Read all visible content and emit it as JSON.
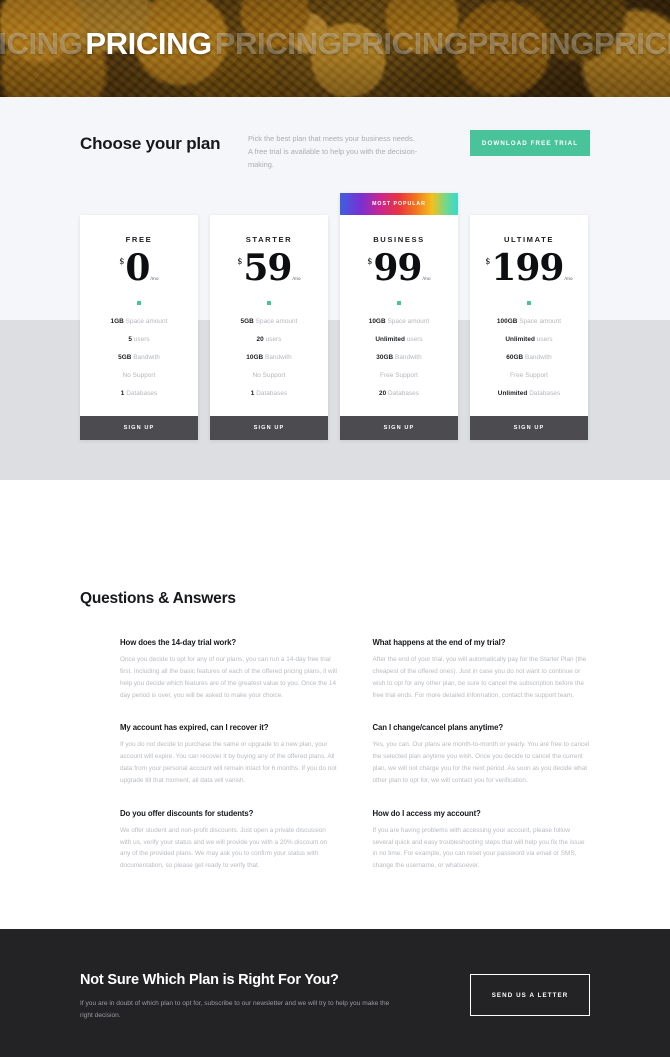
{
  "hero": {
    "title": "PRICING",
    "ghost_before": "PRICING",
    "ghost_after_1": "PRICING",
    "ghost_after_2": "PRICING",
    "ghost_after_3": "PRICING",
    "ghost_after_4": "PRICING",
    "background": "gold-coins-photo"
  },
  "plans_section": {
    "heading": "Choose your plan",
    "subtext": "Pick the best plan that meets your business needs. A free trial is available to help you with the decision-making.",
    "trial_button": "DOWNLOAD FREE TRIAL",
    "accent_color": "#49c49a",
    "signup_button_color": "#4c4c50",
    "cards": [
      {
        "name": "FREE",
        "currency": "$",
        "price": "0",
        "period": "/mo",
        "popular": false,
        "badge": "",
        "features": [
          {
            "strong": "1GB",
            "rest": " Space amount"
          },
          {
            "strong": "5",
            "rest": " users"
          },
          {
            "strong": "5GB",
            "rest": " Bandwith"
          },
          {
            "strong": "",
            "rest": "No Support"
          },
          {
            "strong": "1",
            "rest": " Databases"
          }
        ],
        "cta": "SIGN UP"
      },
      {
        "name": "STARTER",
        "currency": "$",
        "price": "59",
        "period": "/mo",
        "popular": false,
        "badge": "",
        "features": [
          {
            "strong": "5GB",
            "rest": " Space amount"
          },
          {
            "strong": "20",
            "rest": " users"
          },
          {
            "strong": "10GB",
            "rest": " Bandwith"
          },
          {
            "strong": "",
            "rest": "No Support"
          },
          {
            "strong": "1",
            "rest": " Databases"
          }
        ],
        "cta": "SIGN UP"
      },
      {
        "name": "BUSINESS",
        "currency": "$",
        "price": "99",
        "period": "/mo",
        "popular": true,
        "badge": "MOST POPULAR",
        "features": [
          {
            "strong": "10GB",
            "rest": " Space amount"
          },
          {
            "strong": "Unlimited",
            "rest": " users"
          },
          {
            "strong": "30GB",
            "rest": " Bandwith"
          },
          {
            "strong": "",
            "rest": "Free Support"
          },
          {
            "strong": "20",
            "rest": " Databases"
          }
        ],
        "cta": "SIGN UP"
      },
      {
        "name": "ULTIMATE",
        "currency": "$",
        "price": "199",
        "period": "/mo",
        "popular": false,
        "badge": "",
        "features": [
          {
            "strong": "100GB",
            "rest": " Space amount"
          },
          {
            "strong": "Unlimited",
            "rest": " users"
          },
          {
            "strong": "60GB",
            "rest": " Bandwith"
          },
          {
            "strong": "",
            "rest": "Free Support"
          },
          {
            "strong": "Unlimited",
            "rest": " Databases"
          }
        ],
        "cta": "SIGN UP"
      }
    ]
  },
  "qa_section": {
    "heading": "Questions & Answers",
    "items": [
      {
        "question": "How does the 14-day trial work?",
        "answer": "Once you decide to opt for any of our plans, you can run a 14-day free trial first. Including all the basic features of each of the offered pricing plans, it will help you decide which features are of the greatest value to you. Once the 14 day period is over, you will be asked to make your choice."
      },
      {
        "question": "What happens at the end of my trial?",
        "answer": "After the end of your trial, you will automatically pay for the Starter Plan (the cheapest of the offered ones). Just in case you do not want to continue or wish to opt for any other plan, be sure to cancel the subscription before the free trial ends. For more detailed information, contact the support team."
      },
      {
        "question": "My account has expired, can I recover it?",
        "answer": "If you do not decide to purchase the same or upgrade to a new plan, your account will expire. You can recover it by buying any of the offered plans. All data from your personal account will remain intact for 6 months. If you do not upgrade till that moment, all data will vanish."
      },
      {
        "question": "Can I change/cancel plans anytime?",
        "answer": "Yes, you can. Our plans are month-to-month or yearly. You are free to cancel the selected plan anytime you wish. Once you decide to cancel the current plan, we will not charge you for the next period. As soon as you decide what other plan to opt for, we will contact you for verification."
      },
      {
        "question": "Do you offer discounts for students?",
        "answer": "We offer student and non-profit discounts. Just open a private discussion with us, verify your status and we will provide you with a 20% discount on any of the provided plans. We may ask you to confirm your status with documentation, so please get ready to verify that."
      },
      {
        "question": "How do I access my account?",
        "answer": "If you are having problems with accessing your account, please follow several quick and easy troubleshooting steps that will help you fix the issue in no time. For example, you can reset your password via email or SMS, change the username, or whatsoever."
      }
    ]
  },
  "cta_section": {
    "title": "Not Sure Which Plan is Right For You?",
    "subtext": "If you are in doubt of which plan to opt for, subscribe to our newsletter and we will try to help you make the right decision.",
    "button": "SEND US A LETTER",
    "background": "#232326"
  }
}
